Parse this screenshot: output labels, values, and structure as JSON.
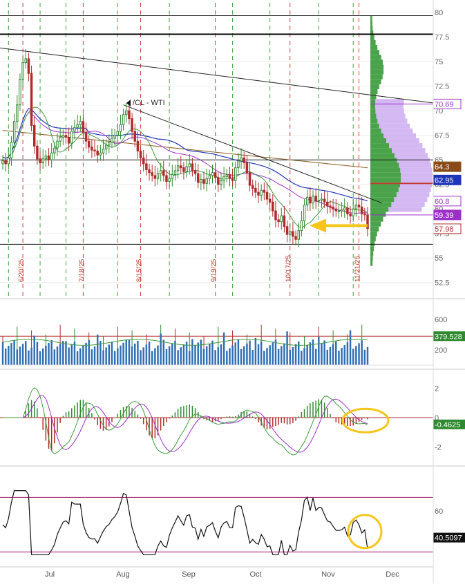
{
  "symbol_label": "/CL - WTI",
  "colors": {
    "up": "#2f8a2f",
    "down": "#b22a2a",
    "volume": "#2e6fb5",
    "ma_green": "#3d9a3d",
    "ma_blue": "#1f35b8",
    "ma_purple": "#9b2fc9",
    "ma_brown": "#8a5a1a",
    "profile_green": "#4aa34a",
    "profile_purple": "#c9a6ef",
    "annotation_yellow": "#f5c518",
    "grid_dash_green": "#3aa63a",
    "grid_dash_red": "#d03a3a",
    "divider": "#c8c8c8"
  },
  "x_axis": {
    "labels": [
      "Jul",
      "Aug",
      "Sep",
      "Oct",
      "Nov",
      "Dec"
    ]
  },
  "event_dates": [
    "6/20/25",
    "7/18/25",
    "8/15/25",
    "9/19/25",
    "10/17/25",
    "11/21/25"
  ],
  "price_panel": {
    "y_ticks": [
      "80",
      "77.5",
      "75",
      "72.5",
      "70",
      "67.5",
      "65",
      "62.5",
      "60",
      "57.5",
      "55",
      "52.5"
    ],
    "value_tags": [
      {
        "value": "70.69",
        "label_color": "#9b2fc9",
        "bg": "#ffffff",
        "text_color": "#9b2fc9"
      },
      {
        "value": "64.3",
        "label_color": "#8a5a1a",
        "bg": "#8a4a1a",
        "text_color": "#ffffff"
      },
      {
        "value": "62.95",
        "label_color": "#1f35b8",
        "bg": "#1f35b8",
        "text_color": "#ffffff"
      },
      {
        "value": "60.8",
        "label_color": "#9b2fc9",
        "bg": "#ffffff",
        "text_color": "#9b2fc9"
      },
      {
        "value": "59.39",
        "label_color": "#9b2fc9",
        "bg": "#9b2fc9",
        "text_color": "#ffffff"
      },
      {
        "value": "57.98",
        "label_color": "#b22a2a",
        "bg": "#ffffff",
        "text_color": "#b22a2a"
      }
    ]
  },
  "volume_panel": {
    "y_ticks": [
      "600",
      "400",
      "200"
    ],
    "value_tag": "379.528"
  },
  "macd_panel": {
    "y_ticks": [
      "2",
      "0",
      "-2"
    ],
    "value_tag": "-0.4625"
  },
  "rsi_panel": {
    "y_ticks": [
      "60",
      "40"
    ],
    "value_tag": "40.5097"
  },
  "chart_data": {
    "type": "candlestick",
    "title": "/CL - WTI",
    "ylim": [
      51,
      81
    ],
    "close": [
      64.9,
      64.6,
      65.2,
      66.8,
      68.9,
      70.6,
      73.2,
      74.9,
      75.3,
      73.8,
      68.5,
      66.4,
      65.1,
      64.7,
      65.1,
      65.4,
      65.0,
      65.7,
      66.2,
      66.9,
      67.3,
      67.5,
      67.3,
      66.7,
      67.9,
      68.3,
      68.6,
      68.9,
      67.8,
      66.9,
      66.3,
      66.0,
      65.9,
      65.5,
      65.7,
      66.1,
      66.5,
      66.8,
      67.2,
      67.5,
      67.9,
      68.6,
      69.6,
      70.0,
      69.2,
      67.9,
      66.9,
      65.9,
      65.2,
      64.6,
      64.0,
      63.7,
      63.4,
      63.1,
      63.6,
      63.9,
      63.4,
      62.8,
      63.1,
      63.5,
      63.9,
      64.4,
      64.2,
      63.8,
      64.3,
      64.6,
      63.9,
      63.6,
      62.7,
      63.0,
      62.6,
      63.1,
      63.4,
      63.7,
      63.2,
      62.5,
      62.9,
      63.3,
      63.5,
      63.1,
      62.9,
      64.2,
      64.9,
      65.2,
      64.7,
      63.7,
      62.4,
      62.1,
      61.7,
      61.4,
      61.9,
      61.7,
      61.0,
      60.7,
      59.8,
      58.9,
      58.7,
      59.3,
      58.2,
      57.4,
      57.7,
      57.2,
      56.9,
      57.8,
      58.8,
      60.4,
      61.2,
      60.6,
      61.3,
      60.8,
      60.9,
      61.0,
      60.7,
      60.3,
      60.2,
      60.0,
      59.8,
      59.8,
      59.9,
      60.1,
      59.5,
      59.3,
      60.0,
      60.4,
      60.2,
      59.5,
      59.4,
      58.0
    ],
    "x_labels": [
      "Jul",
      "Aug",
      "Sep",
      "Oct",
      "Nov",
      "Dec"
    ],
    "volume_ylim": [
      0,
      800
    ],
    "macd_ylim": [
      -3,
      3
    ],
    "rsi_ylim": [
      20,
      90
    ],
    "rsi_levels": [
      70,
      30
    ],
    "horizontal_levels": [
      77.8,
      56.4,
      65.0,
      79.7
    ],
    "volume_avg": 379.528,
    "macd_last": -0.4625,
    "rsi_last": 40.5097
  }
}
